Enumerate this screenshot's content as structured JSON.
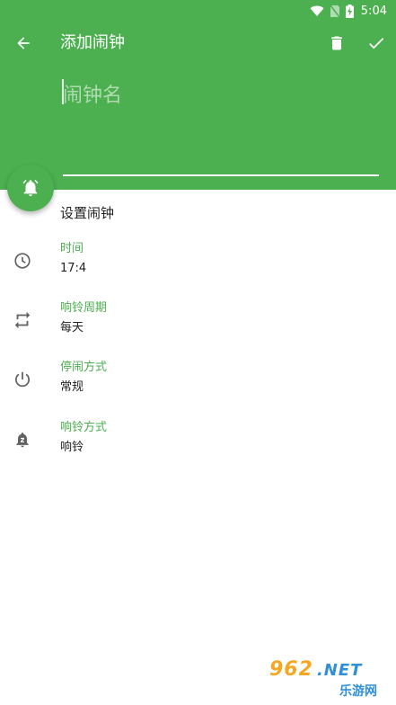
{
  "status_bar": {
    "time": "5:04"
  },
  "toolbar": {
    "title": "添加闹钟"
  },
  "name_field": {
    "placeholder": "闹钟名",
    "value": ""
  },
  "section": {
    "title": "设置闹钟"
  },
  "settings": [
    {
      "label": "时间",
      "value": "17:4",
      "icon": "clock-icon"
    },
    {
      "label": "响铃周期",
      "value": "每天",
      "icon": "repeat-icon"
    },
    {
      "label": "停闹方式",
      "value": "常规",
      "icon": "power-icon"
    },
    {
      "label": "响铃方式",
      "value": "响铃",
      "icon": "snooze-bell-icon"
    }
  ],
  "colors": {
    "primary": "#4caf50",
    "text_dark": "#212121",
    "icon_gray": "#616161"
  },
  "watermark": {
    "main": "962",
    "net": ".NET",
    "sub": "乐游网"
  }
}
